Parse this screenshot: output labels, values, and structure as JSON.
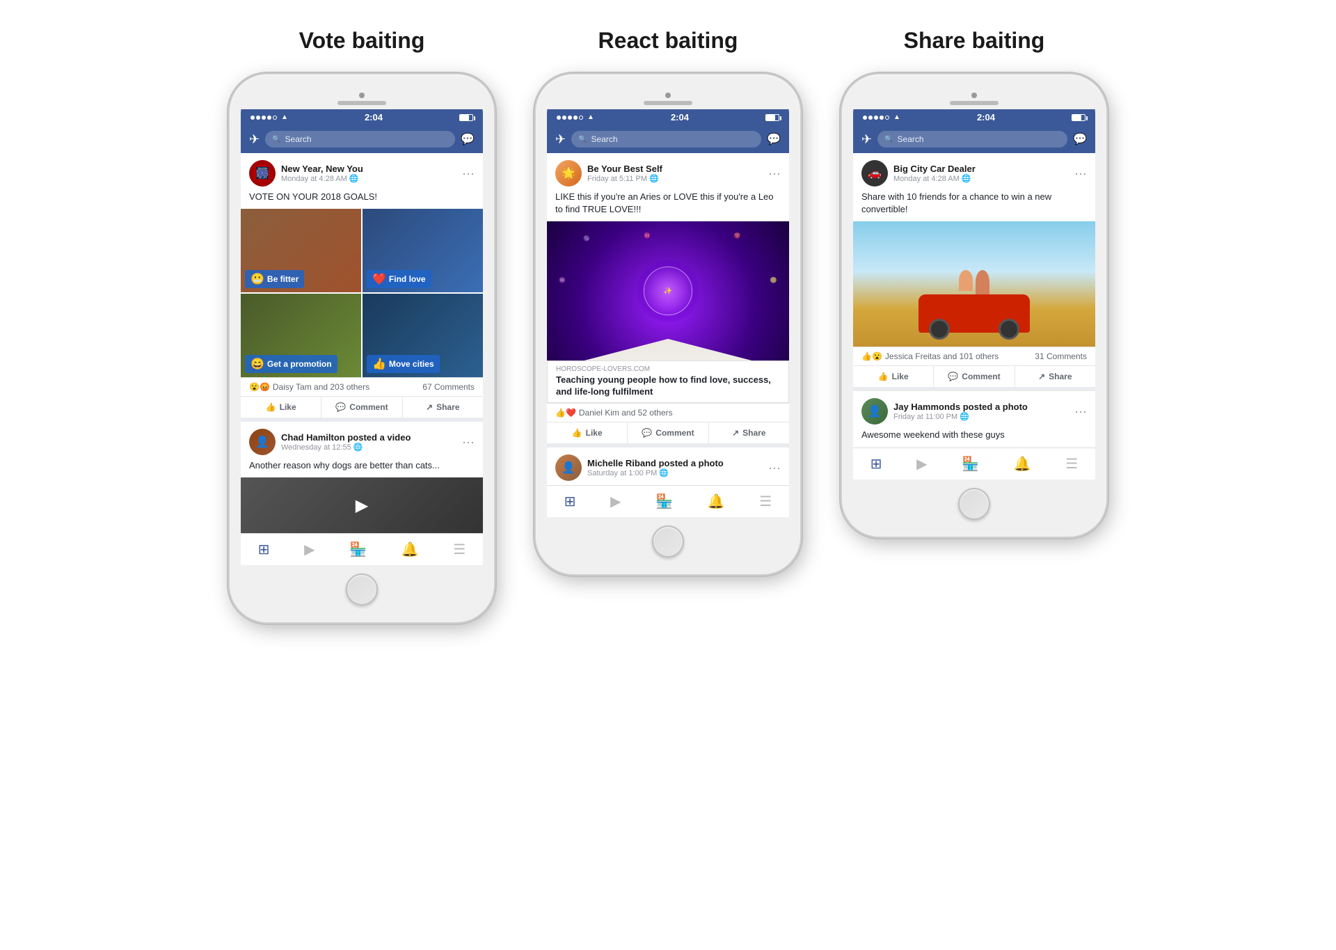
{
  "sections": [
    {
      "title": "Vote baiting",
      "status_time": "2:04",
      "search_placeholder": "Search",
      "post1": {
        "page_name": "New Year, New You",
        "post_time": "Monday at 4:28 AM",
        "post_text": "VOTE ON YOUR 2018 GOALS!",
        "vote_options": [
          {
            "label": "Be fitter",
            "emoji": "😬"
          },
          {
            "label": "Find love",
            "emoji": "❤️"
          },
          {
            "label": "Get a promotion",
            "emoji": "😄"
          },
          {
            "label": "Move cities",
            "emoji": "👍"
          }
        ],
        "reactions": "😮😡 Daisy Tam and 203 others",
        "comments": "67 Comments"
      },
      "post2": {
        "name": "Chad Hamilton",
        "action": "posted a video",
        "time": "Wednesday at 12:55",
        "text": "Another reason why dogs are better than cats..."
      },
      "actions": [
        "Like",
        "Comment",
        "Share"
      ]
    },
    {
      "title": "React baiting",
      "status_time": "2:04",
      "search_placeholder": "Search",
      "post1": {
        "page_name": "Be Your Best Self",
        "post_time": "Friday at 5:11 PM",
        "post_text": "LIKE this if you're an Aries or LOVE this if you're a Leo to find TRUE LOVE!!!",
        "link_domain": "HOROSCOPE-LOVERS.COM",
        "link_title": "Teaching young people how to find love, success, and life-long fulfilment",
        "reactions": "👍❤️ Daniel Kim and 52 others",
        "comments": ""
      },
      "post2": {
        "name": "Michelle Riband",
        "action": "posted a photo",
        "time": "Saturday at 1:00 PM",
        "text": ""
      },
      "actions": [
        "Like",
        "Comment",
        "Share"
      ]
    },
    {
      "title": "Share baiting",
      "status_time": "2:04",
      "search_placeholder": "Search",
      "post1": {
        "page_name": "Big City Car Dealer",
        "post_time": "Monday at 4:28 AM",
        "post_text": "Share with 10 friends for a chance to win a new convertible!",
        "reactions": "👍😮 Jessica Freitas and 101 others",
        "comments": "31 Comments"
      },
      "post2": {
        "name": "Jay Hammonds",
        "action": "posted a photo",
        "time": "Friday at 11:00 PM",
        "text": "Awesome weekend with these guys"
      },
      "actions": [
        "Like",
        "Comment",
        "Share"
      ]
    }
  ],
  "nav_icons": [
    "🏠",
    "▶",
    "🏪",
    "🔔",
    "☰"
  ],
  "like_label": "Like",
  "comment_label": "Comment",
  "share_label": "Share"
}
